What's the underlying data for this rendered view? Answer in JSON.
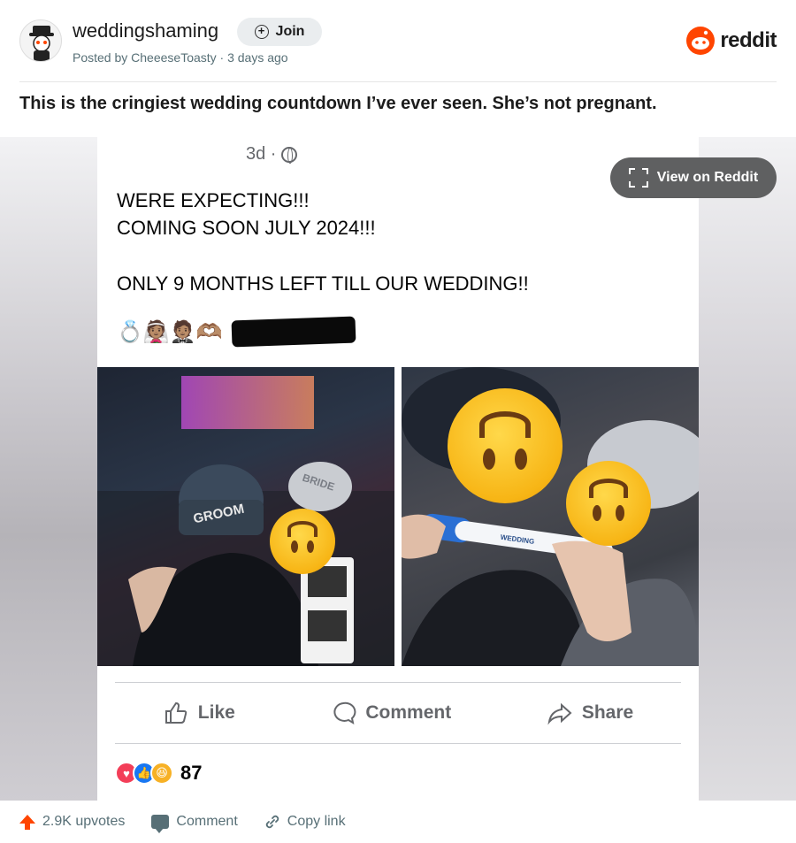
{
  "header": {
    "subreddit": "weddingshaming",
    "join_label": "Join",
    "posted_by": "Posted by CheeeseToasty · 3 days ago",
    "brand": "reddit"
  },
  "post": {
    "title": "This is the cringiest wedding countdown I’ve ever seen. She’s not pregnant."
  },
  "view_button": "View on Reddit",
  "fb_post": {
    "time": "3d ·",
    "lines": [
      "WERE EXPECTING!!!",
      "COMING SOON JULY 2024!!!",
      "ONLY 9 MONTHS LEFT TILL OUR WEDDING!!"
    ],
    "emojis": "💍👰🏽🤵🏽🫶🏽",
    "photo_text": {
      "groom_hat": "GROOM",
      "bride_hat": "BRIDE",
      "test_label": "WEDDING"
    },
    "actions": {
      "like": "Like",
      "comment": "Comment",
      "share": "Share"
    },
    "reaction_count": "87"
  },
  "footer": {
    "upvotes": "2.9K upvotes",
    "comment": "Comment",
    "copy_link": "Copy link"
  },
  "colors": {
    "reddit_orange": "#ff4500",
    "fb_gray": "#65676b",
    "view_button_bg": "#5f6061"
  }
}
